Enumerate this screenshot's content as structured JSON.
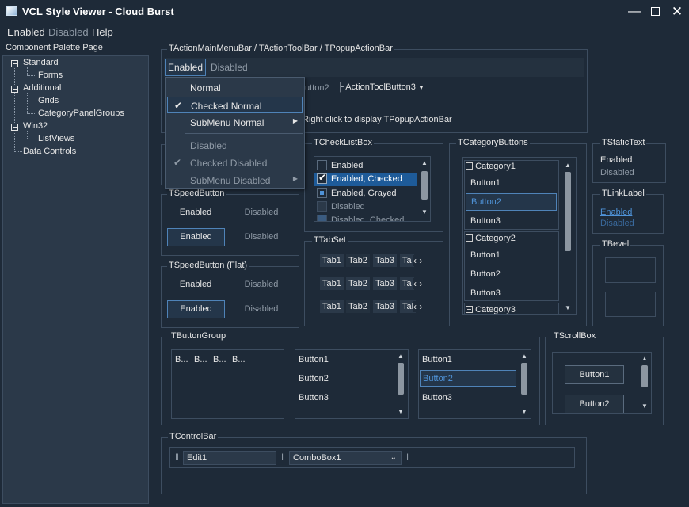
{
  "window": {
    "title": "VCL Style Viewer - Cloud Burst"
  },
  "menubar": {
    "items": [
      "Enabled",
      "Disabled",
      "Help"
    ]
  },
  "palette": {
    "label": "Component Palette Page",
    "tree": [
      {
        "label": "Standard",
        "children": [
          "Forms"
        ]
      },
      {
        "label": "Additional",
        "children": [
          "Grids",
          "CategoryPanelGroups"
        ]
      },
      {
        "label": "Win32",
        "children": [
          "ListViews"
        ]
      },
      {
        "label": "Data Controls",
        "children": []
      }
    ]
  },
  "action_bar": {
    "caption": "TActionMainMenuBar / TActionToolBar / TPopupActionBar",
    "menu_items": [
      "Enabled",
      "Disabled"
    ],
    "toolbar_button_partial": "utton2",
    "toolbar_button3": "ActionToolButton3",
    "popup_hint": "Right click to display TPopupActionBar"
  },
  "dropdown": {
    "items": [
      {
        "label": "Normal",
        "checked": false,
        "submenu": false,
        "disabled": false
      },
      {
        "label": "Checked Normal",
        "checked": true,
        "submenu": false,
        "disabled": false,
        "selected": true
      },
      {
        "label": "SubMenu Normal",
        "checked": false,
        "submenu": true,
        "disabled": false
      },
      {
        "label": "Disabled",
        "checked": false,
        "submenu": false,
        "disabled": true
      },
      {
        "label": "Checked Disabled",
        "checked": true,
        "submenu": false,
        "disabled": true
      },
      {
        "label": "SubMenu Disabled",
        "checked": false,
        "submenu": true,
        "disabled": true
      }
    ]
  },
  "speed_button": {
    "caption": "TSpeedButton",
    "enabled": "Enabled",
    "disabled": "Disabled",
    "enabled2": "Enabled",
    "disabled2": "Disabled"
  },
  "speed_button_flat": {
    "caption": "TSpeedButton (Flat)",
    "enabled": "Enabled",
    "disabled": "Disabled",
    "enabled2": "Enabled",
    "disabled2": "Disabled"
  },
  "checklistbox": {
    "caption": "TCheckListBox",
    "items": [
      {
        "label": "Enabled",
        "state": "unchecked"
      },
      {
        "label": "Enabled, Checked",
        "state": "checked"
      },
      {
        "label": "Enabled, Grayed",
        "state": "grayed"
      },
      {
        "label": "Disabled",
        "state": "disabled"
      },
      {
        "label": "Disabled, Checked",
        "state": "disabled-checked"
      }
    ]
  },
  "tabset": {
    "caption": "TTabSet",
    "rows": [
      [
        "Tab1",
        "Tab2",
        "Tab3",
        "Ta"
      ],
      [
        "Tab1",
        "Tab2",
        "Tab3",
        "Ta"
      ],
      [
        "Tab1",
        "Tab2",
        "Tab3",
        "Tal"
      ]
    ]
  },
  "category_buttons": {
    "caption": "TCategoryButtons",
    "categories": [
      {
        "name": "Category1",
        "buttons": [
          "Button1",
          "Button2",
          "Button3"
        ]
      },
      {
        "name": "Category2",
        "buttons": [
          "Button1",
          "Button2",
          "Button3"
        ]
      },
      {
        "name": "Category3",
        "buttons": []
      }
    ]
  },
  "static_text": {
    "caption": "TStaticText",
    "enabled": "Enabled",
    "disabled": "Disabled"
  },
  "link_label": {
    "caption": "TLinkLabel",
    "enabled": "Enabled",
    "disabled": "Disabled"
  },
  "bevel": {
    "caption": "TBevel"
  },
  "button_group": {
    "caption": "TButtonGroup",
    "compact": [
      "B...",
      "B...",
      "B...",
      "B..."
    ],
    "list1": [
      "Button1",
      "Button2",
      "Button3"
    ],
    "list2": [
      "Button1",
      "Button2",
      "Button3"
    ]
  },
  "scroll_box": {
    "caption": "TScrollBox",
    "buttons": [
      "Button1",
      "Button2"
    ]
  },
  "control_bar": {
    "caption": "TControlBar",
    "edit": "Edit1",
    "combo": "ComboBox1"
  },
  "colors": {
    "background": "#1e2a38",
    "panel": "#2b3949",
    "accent": "#4f83b8",
    "selection": "#1e5b99"
  }
}
